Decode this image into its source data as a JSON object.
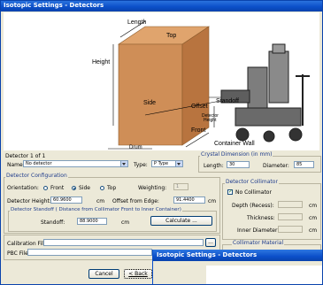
{
  "window": {
    "title": "Isotopic Settings - Detectors"
  },
  "illustration": {
    "labels": {
      "length": "Length",
      "top": "Top",
      "height": "Height",
      "side": "Side",
      "offset": "Offset",
      "standoff": "Standoff",
      "detector_height": "Detector\nHeight",
      "front": "Front",
      "container_wall": "Container Wall",
      "drum": "Drum"
    }
  },
  "detector_nav": {
    "label": "Detector 1 of 1"
  },
  "name_row": {
    "label": "Name:",
    "value": "No detector",
    "type_label": "Type:",
    "type_value": "P Type"
  },
  "crystal": {
    "legend": "Crystal Dimension (in mm)",
    "length_label": "Length:",
    "length_value": "30",
    "diameter_label": "Diameter:",
    "diameter_value": "85"
  },
  "config": {
    "legend": "Detector Configuration",
    "orientation_label": "Orientation:",
    "orientation_options": [
      "Front",
      "Side",
      "Top"
    ],
    "orientation_selected": "Side",
    "weighting_label": "Weighting:",
    "weighting_value": "1",
    "height_label": "Detector Height:",
    "height_value": "60.9600",
    "height_unit": "cm",
    "offset_label": "Offset from Edge:",
    "offset_value": "91.4400",
    "offset_unit": "cm",
    "standoff_legend": "Detector Standoff ( Distance from Collimator Front to Inner Container)",
    "standoff_label": "Standoff:",
    "standoff_value": "88.9000",
    "standoff_unit": "cm",
    "calculate_label": "Calculate ..."
  },
  "collimator": {
    "legend": "Detector Collimator",
    "no_collimator_label": "No Collimator",
    "no_collimator_checked": true,
    "depth_label": "Depth (Recess):",
    "thickness_label": "Thickness:",
    "inner_diameter_label": "Inner Diameter:",
    "unit": "cm",
    "material_legend": "Collimator Material"
  },
  "files": {
    "calibration_label": "Calibration File:",
    "calibration_browse": "...",
    "pbc_label": "PBC File:"
  },
  "buttons": {
    "cancel": "Cancel",
    "back": "< Back"
  },
  "overlay_window": {
    "title": "Isotopic Settings - Detectors"
  },
  "colors": {
    "titlebar": "#0b4fc9",
    "dialog_bg": "#ece9d8",
    "box": "#cf8e57",
    "legend_text": "#1e3c8c"
  }
}
